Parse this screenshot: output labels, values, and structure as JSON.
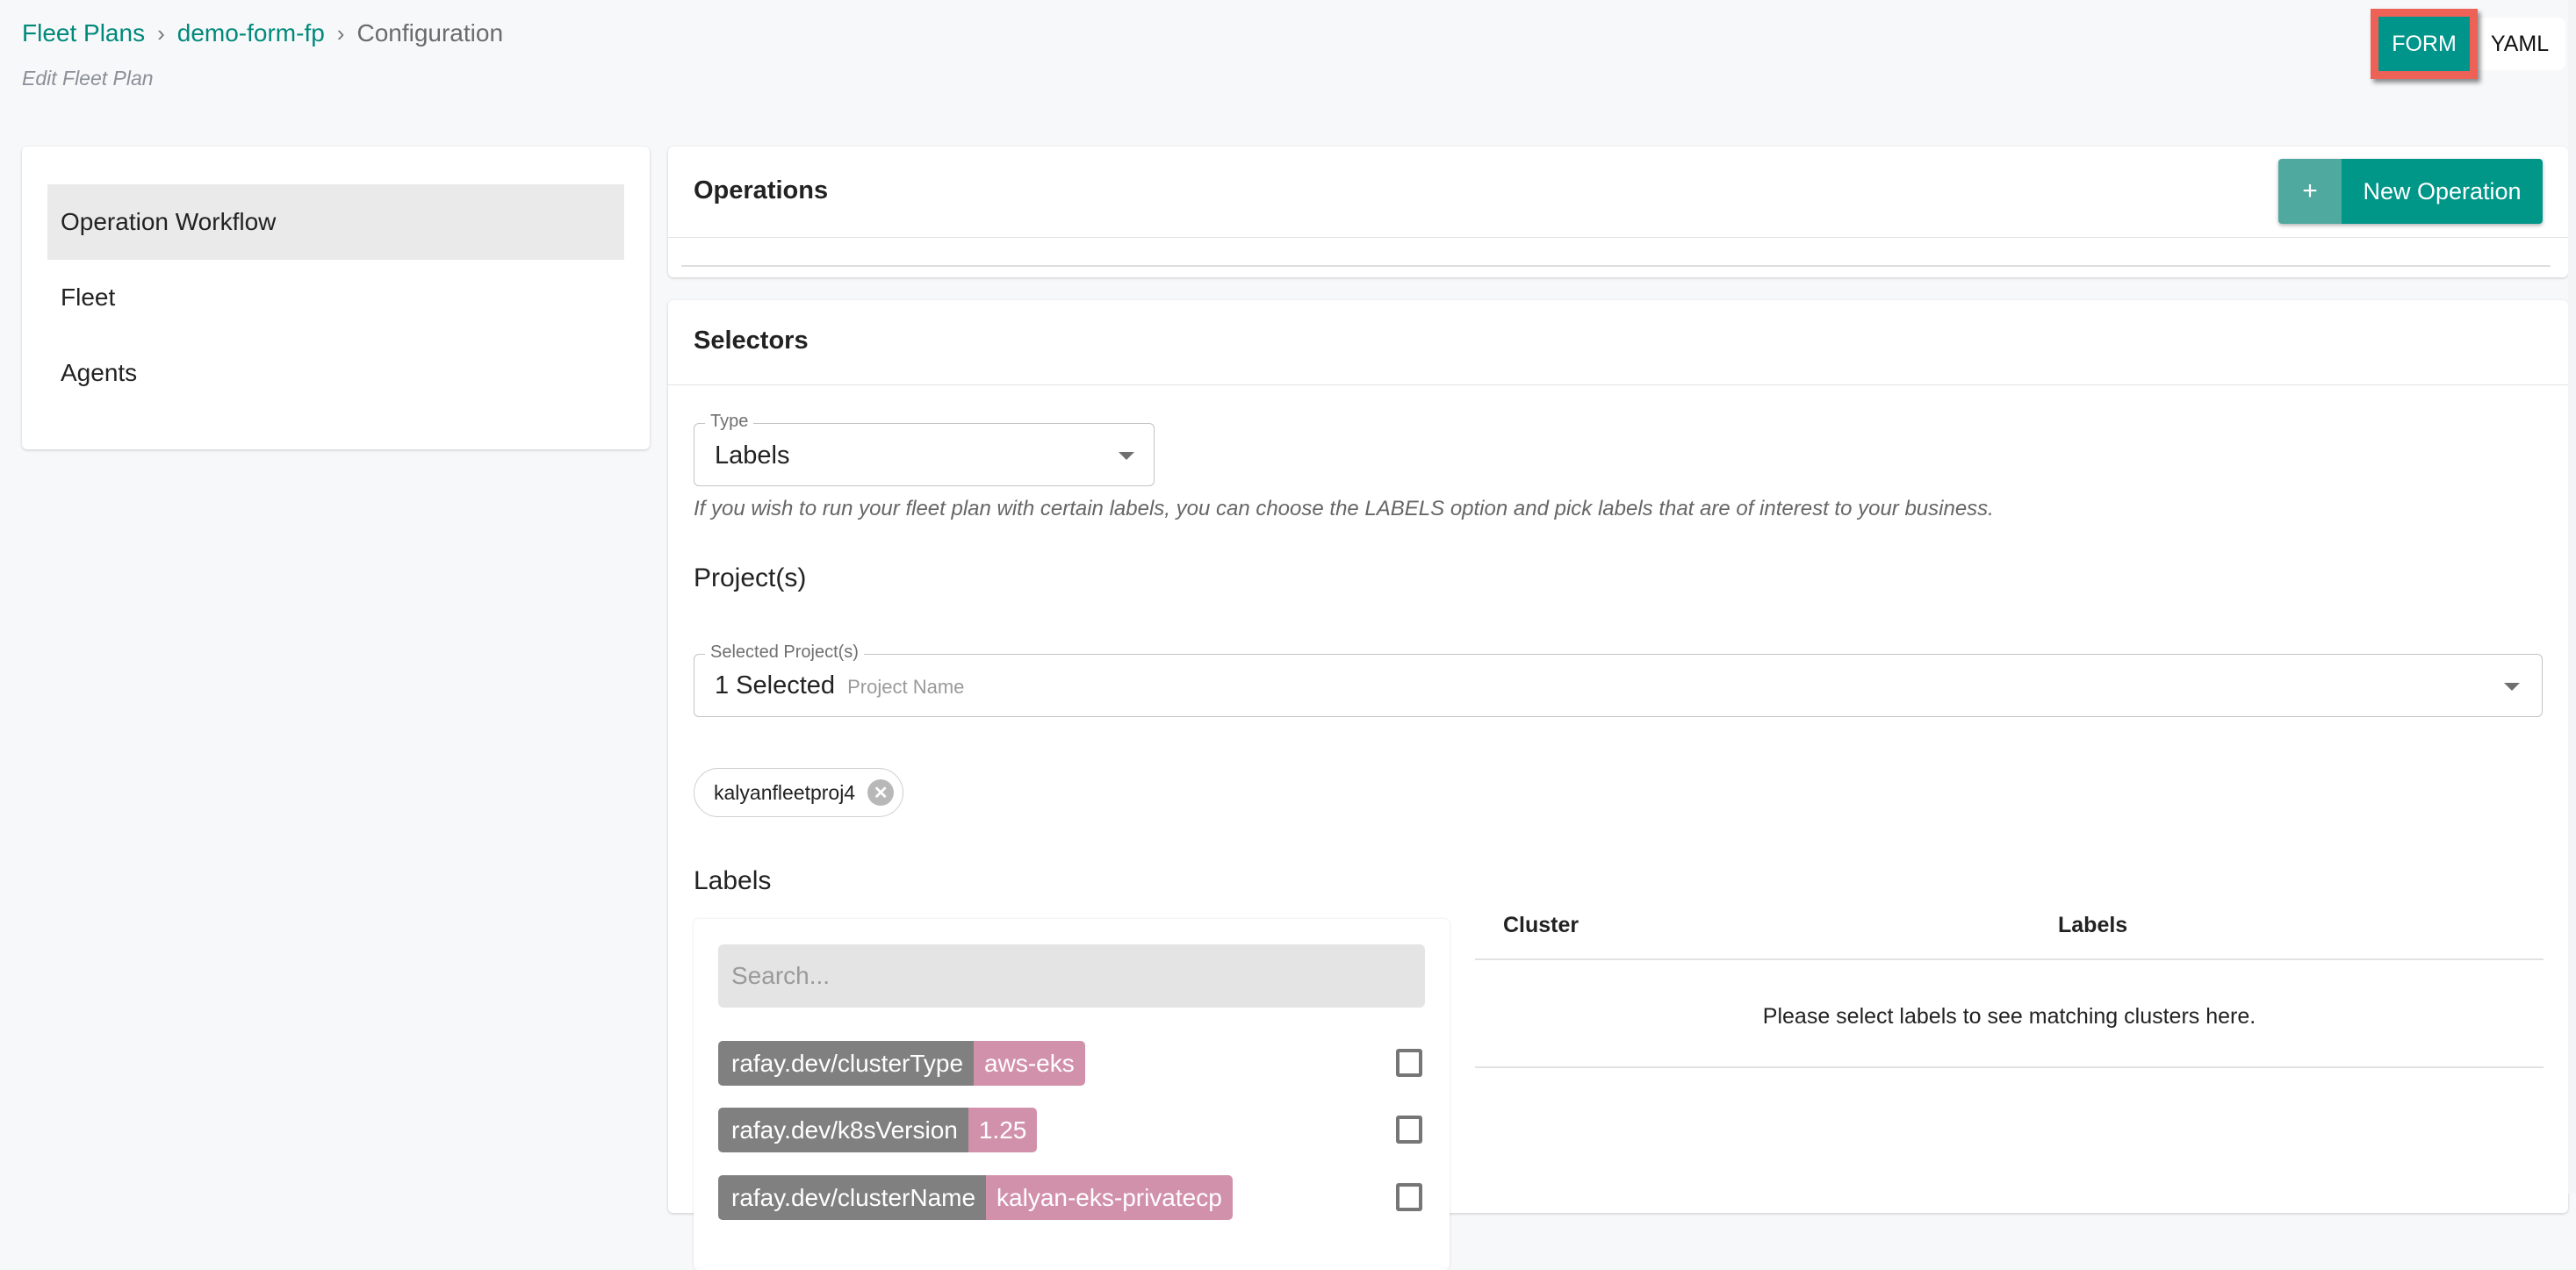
{
  "header": {
    "breadcrumb": [
      {
        "label": "Fleet Plans",
        "link": true
      },
      {
        "label": "demo-form-fp",
        "link": true
      },
      {
        "label": "Configuration",
        "link": false
      }
    ],
    "separator": "›",
    "subtitle": "Edit Fleet Plan",
    "view_toggle": {
      "form_label": "FORM",
      "yaml_label": "YAML",
      "active": "FORM"
    }
  },
  "sidebar": {
    "items": [
      {
        "label": "Operation Workflow",
        "active": true
      },
      {
        "label": "Fleet",
        "active": false
      },
      {
        "label": "Agents",
        "active": false
      }
    ]
  },
  "operations": {
    "title": "Operations",
    "new_button": {
      "icon": "plus-icon",
      "icon_glyph": "+",
      "label": "New Operation"
    }
  },
  "selectors": {
    "title": "Selectors",
    "type_field": {
      "legend": "Type",
      "value": "Labels"
    },
    "help_text": "If you wish to run your fleet plan with certain labels, you can choose the LABELS option and pick labels that are of interest to your business.",
    "projects_heading": "Project(s)",
    "projects_field": {
      "legend": "Selected Project(s)",
      "value": "1 Selected",
      "placeholder": "Project Name"
    },
    "selected_projects": [
      {
        "label": "kalyanfleetproj4",
        "remove_glyph": "✕"
      }
    ],
    "labels_heading": "Labels",
    "labels_search_placeholder": "Search...",
    "labels": [
      {
        "key": "rafay.dev/clusterType",
        "value": "aws-eks",
        "checked": false
      },
      {
        "key": "rafay.dev/k8sVersion",
        "value": "1.25",
        "checked": false
      },
      {
        "key": "rafay.dev/clusterName",
        "value": "kalyan-eks-privatecp",
        "checked": false
      }
    ],
    "match_table": {
      "columns": [
        "Cluster",
        "Labels"
      ],
      "empty_message": "Please select labels to see matching clusters here."
    }
  },
  "colors": {
    "accent": "#009688",
    "accent_light": "#4fa99e",
    "highlight_border": "#ee6157",
    "label_key_bg": "#808080",
    "label_value_bg": "#d291aa"
  }
}
